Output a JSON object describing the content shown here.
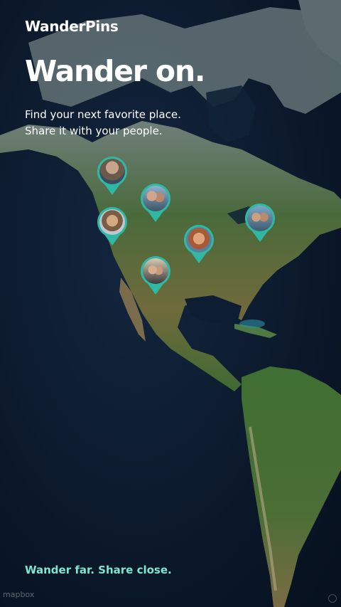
{
  "app": {
    "brand": "WanderPins",
    "headline": "Wander on.",
    "tagline_line1": "Find your next favorite place.",
    "tagline_line2": "Share it with your people.",
    "bottom_slogan": "Wander far. Share close.",
    "map_attribution": "mapbox"
  },
  "colors": {
    "accent": "#2fb9a5",
    "slogan": "#7fe6cf",
    "ocean": "#0b1a2e"
  },
  "pins": [
    {
      "name": "pin-pacific-northwest",
      "photo": "person-photo"
    },
    {
      "name": "pin-idaho",
      "photo": "people-photo"
    },
    {
      "name": "pin-oregon-coast",
      "photo": "person-photo"
    },
    {
      "name": "pin-colorado",
      "photo": "person-photo"
    },
    {
      "name": "pin-great-lakes",
      "photo": "people-photo"
    },
    {
      "name": "pin-southwest",
      "photo": "people-photo"
    }
  ]
}
